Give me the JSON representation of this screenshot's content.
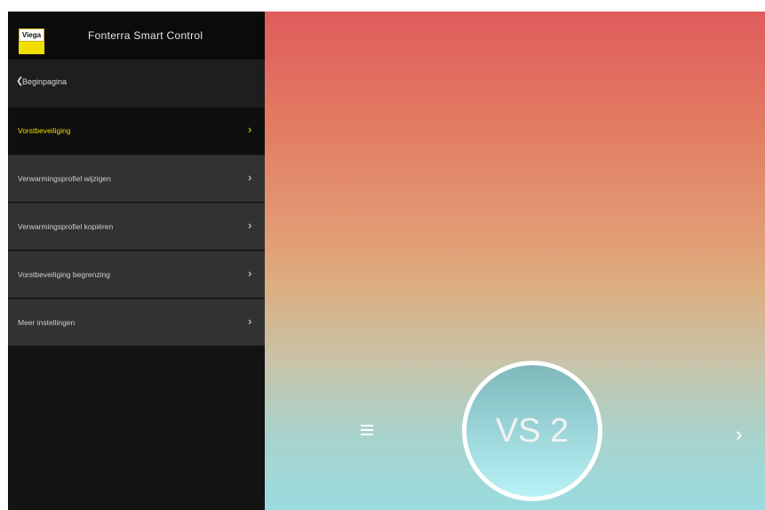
{
  "header": {
    "logo_text": "Viega",
    "app_title": "Fonterra Smart Control"
  },
  "nav": {
    "back_label": "Beginpagina"
  },
  "menu": {
    "items": [
      {
        "label": "Vorstbeveiliging",
        "active": true
      },
      {
        "label": "Verwarmingsprofiel wijzigen",
        "active": false
      },
      {
        "label": "Verwarmingsprofiel kopiëren",
        "active": false
      },
      {
        "label": "Vorstbeveiliging begrenzing",
        "active": false
      },
      {
        "label": "Meer instellingen",
        "active": false
      }
    ]
  },
  "main": {
    "zone_label": "VS 2"
  },
  "icons": {
    "back": "chevron-left-icon",
    "menu_chevron": "chevron-right-icon",
    "hamburger": "hamburger-menu-icon",
    "next": "chevron-right-icon"
  },
  "colors": {
    "accent": "#e8d800",
    "sidebar_bg": "#131313",
    "menu_item_bg": "#323232",
    "gradient_top": "#e05c5c",
    "gradient_bottom": "#9adbdf"
  }
}
